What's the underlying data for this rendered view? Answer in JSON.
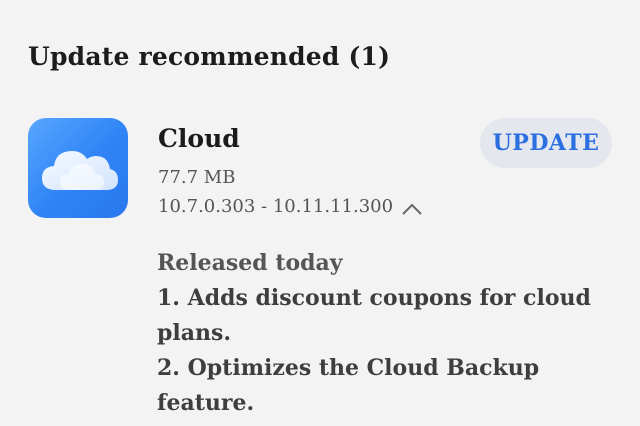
{
  "section": {
    "title": "Update recommended (1)"
  },
  "app": {
    "name": "Cloud",
    "size": "77.7 MB",
    "version": "10.7.0.303 - 10.11.11.300",
    "icon": "cloud-icon",
    "icon_color": "#3a8cf7"
  },
  "actions": {
    "update_label": "UPDATE",
    "update_color": "#2c6fe0"
  },
  "release_notes": {
    "heading": "Released today",
    "items": [
      "1. Adds discount coupons for cloud plans.",
      "2. Optimizes the Cloud Backup feature."
    ]
  }
}
